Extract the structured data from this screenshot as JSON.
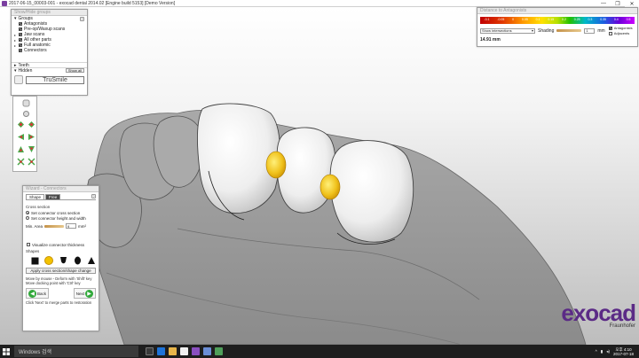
{
  "window": {
    "title": "2017-06-15_00003-001 - exocad dental 2014.02 [Engine build 5153] [Demo Version]",
    "controls": [
      "—",
      "❐",
      "✕"
    ]
  },
  "groups_panel": {
    "header": "Show/Hide groups",
    "groups_label": "Groups",
    "help": "?",
    "items": [
      {
        "label": "Antagonists",
        "checked": true,
        "expandable": false
      },
      {
        "label": "Pre-op/Waxup scans",
        "checked": true,
        "expandable": false
      },
      {
        "label": "Jaw scans",
        "checked": true,
        "expandable": true
      },
      {
        "label": "All other parts",
        "checked": true,
        "expandable": true
      },
      {
        "label": "Full anatomic",
        "checked": true,
        "expandable": true
      },
      {
        "label": "Connectors",
        "checked": true,
        "expandable": false
      }
    ],
    "teeth_label": "Teeth",
    "hidden_label": "Hidden",
    "show_all": "Show all",
    "trusmile": "TruSmile"
  },
  "distance_panel": {
    "header": "Distance to Antagonists",
    "ticks": [
      "-0.1",
      "-0.05",
      "0",
      "0.05",
      "0.1",
      "0.15",
      "0.2",
      "0.25",
      "0.3",
      "0.35",
      "0.4",
      "0.5"
    ],
    "select_value": "Show intersections",
    "shading_label": "Shading",
    "shading_value": "1",
    "unit": "mm",
    "options": [
      {
        "label": "Antagonists",
        "checked": true
      },
      {
        "label": "Adjacents",
        "checked": false
      }
    ],
    "value": "14.91 mm"
  },
  "wizard": {
    "header": "Wizard - Connectors",
    "tabs": [
      "Shape",
      "Free"
    ],
    "cross_section_label": "Cross section",
    "radio_options": [
      {
        "label": "Set connector cross section",
        "selected": true
      },
      {
        "label": "Set connector height and width",
        "selected": false
      }
    ],
    "min_area_label": "Min. Area",
    "min_area_value": "9",
    "min_area_unit": "mm²",
    "visualize_label": "Visualize connector thickness",
    "shapes_label": "Shapes",
    "apply_label": "Apply cross section/shape change",
    "note_1": "Move by mouse - Deform with 'Shift' key",
    "note_2": "Move docking point with 'Ctrl' key",
    "back_label": "Back",
    "next_label": "Next",
    "footer": "Click 'Next' to merge parts to restoration",
    "help": "?"
  },
  "logo": {
    "word": "exocad",
    "sub": "Fraunhofer"
  },
  "taskbar": {
    "search_placeholder": "Windows 검색",
    "time": "4:10",
    "ampm": "오후",
    "date": "2017-07-18"
  }
}
